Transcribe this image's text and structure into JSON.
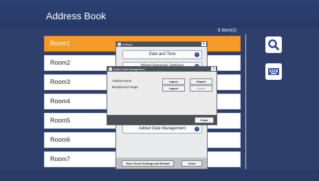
{
  "header": {
    "title": "Address Book",
    "item_count": "9 item(s)"
  },
  "rooms": [
    "Room1",
    "Room2",
    "Room3",
    "Room4",
    "Room5",
    "Room6",
    "Room7"
  ],
  "selected_index": 0,
  "side_buttons": [
    {
      "icon": "search-icon"
    },
    {
      "icon": "keyboard-icon"
    }
  ],
  "settings_dialog": {
    "title": "Settings",
    "items": [
      "Date and Time",
      "Wired Network Settings",
      "Added Data Management"
    ],
    "footer_buttons": [
      "Store Scene Settings and Restart",
      "Close"
    ]
  },
  "adm_dialog": {
    "title": "Added Data Management",
    "rows": [
      {
        "label": "Address Book",
        "import": "Import",
        "export": "Export"
      },
      {
        "label": "Background Image",
        "import": "Import",
        "export": "Delete"
      }
    ],
    "close": "Close"
  },
  "colors": {
    "background": "#2e3f6b",
    "selected": "#f29a2a",
    "arrow": "#2f4a9a"
  }
}
